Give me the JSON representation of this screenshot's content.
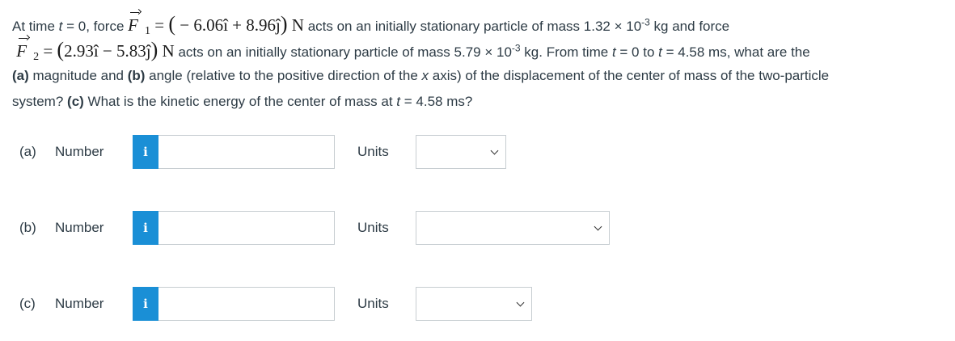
{
  "question": {
    "l1_a": "At time ",
    "l1_t": "t",
    "l1_b": " = 0, force ",
    "f_letter": "F",
    "f1_sub": "1",
    "eq": " = ",
    "f1_expr": "− 6.06î + 8.96ĵ",
    "unit_N": "N",
    "l1_c": " acts on an initially stationary particle of mass 1.32 × 10",
    "exp": "-3",
    "l1_d": " kg and force",
    "f2_sub": "2",
    "f2_expr": "2.93î − 5.83ĵ",
    "l2_c": " acts on an initially stationary particle of mass 5.79 × 10",
    "l2_d": " kg. From time ",
    "l2_e": " = 0 to ",
    "l2_f": " = 4.58 ms, what are the",
    "l3_a_bold": "(a)",
    "l3_a": " magnitude and ",
    "l3_b_bold": "(b)",
    "l3_b": " angle (relative to the positive direction of the ",
    "l3_x": "x",
    "l3_c": " axis) of the displacement of the center of mass of the two-particle",
    "l4_a": "system? ",
    "l4_c_bold": "(c)",
    "l4_b": " What is the kinetic energy of the center of mass at ",
    "l4_t": "t",
    "l4_c": " = 4.58 ms?"
  },
  "answers": [
    {
      "part": "(a)",
      "number_label": "Number",
      "info_icon": "i",
      "value": "",
      "units_label": "Units",
      "units_selected": ""
    },
    {
      "part": "(b)",
      "number_label": "Number",
      "info_icon": "i",
      "value": "",
      "units_label": "Units",
      "units_selected": ""
    },
    {
      "part": "(c)",
      "number_label": "Number",
      "info_icon": "i",
      "value": "",
      "units_label": "Units",
      "units_selected": ""
    }
  ],
  "colors": {
    "info_button": "#1a8fd6",
    "border": "#c7cdd1",
    "text": "#2d3b45"
  }
}
